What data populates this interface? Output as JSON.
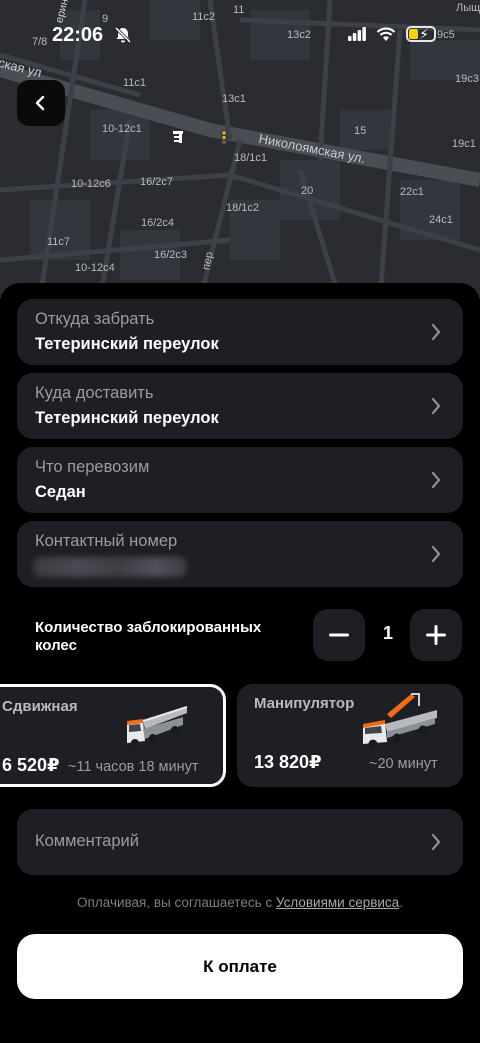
{
  "status_bar": {
    "time": "22:06"
  },
  "map": {
    "labels": [
      "11",
      "11c2",
      "9",
      "7/8",
      "13c2",
      "9c5",
      "Лыщ",
      "19c3",
      "11c1",
      "13c1",
      "10-12c1",
      "15",
      "19c1",
      "18/1c1",
      "16/2c7",
      "10-12c6",
      "20",
      "22c1",
      "18/1c2",
      "16/2c4",
      "24c1",
      "11c7",
      "16/2c3",
      "10-12c4",
      "пер"
    ],
    "streets": [
      "ская ул",
      "Николоямская ул.",
      "ерин"
    ]
  },
  "fields": {
    "from": {
      "label": "Откуда забрать",
      "value": "Тетеринский переулок"
    },
    "to": {
      "label": "Куда доставить",
      "value": "Тетеринский переулок"
    },
    "cargo": {
      "label": "Что перевозим",
      "value": "Седан"
    },
    "contact": {
      "label": "Контактный номер"
    }
  },
  "wheels": {
    "label": "Количество заблокированных колес",
    "count": "1"
  },
  "tariffs": [
    {
      "title": "Сдвижная",
      "price": "6 520₽",
      "eta": "~11 часов 18 минут",
      "selected": true
    },
    {
      "title": "Манипулятор",
      "price": "13 820₽",
      "eta": "~20 минут",
      "selected": false
    }
  ],
  "comment": {
    "label": "Комментарий"
  },
  "terms": {
    "prefix": "Оплачивая, вы соглашаетесь с ",
    "link": "Условиями сервиса",
    "suffix": "."
  },
  "pay_button": {
    "label": "К оплате"
  },
  "colors": {
    "background": "#000000",
    "card": "#1e1f24",
    "map": "#2a2c31",
    "accent_orange": "#f26a1b"
  }
}
